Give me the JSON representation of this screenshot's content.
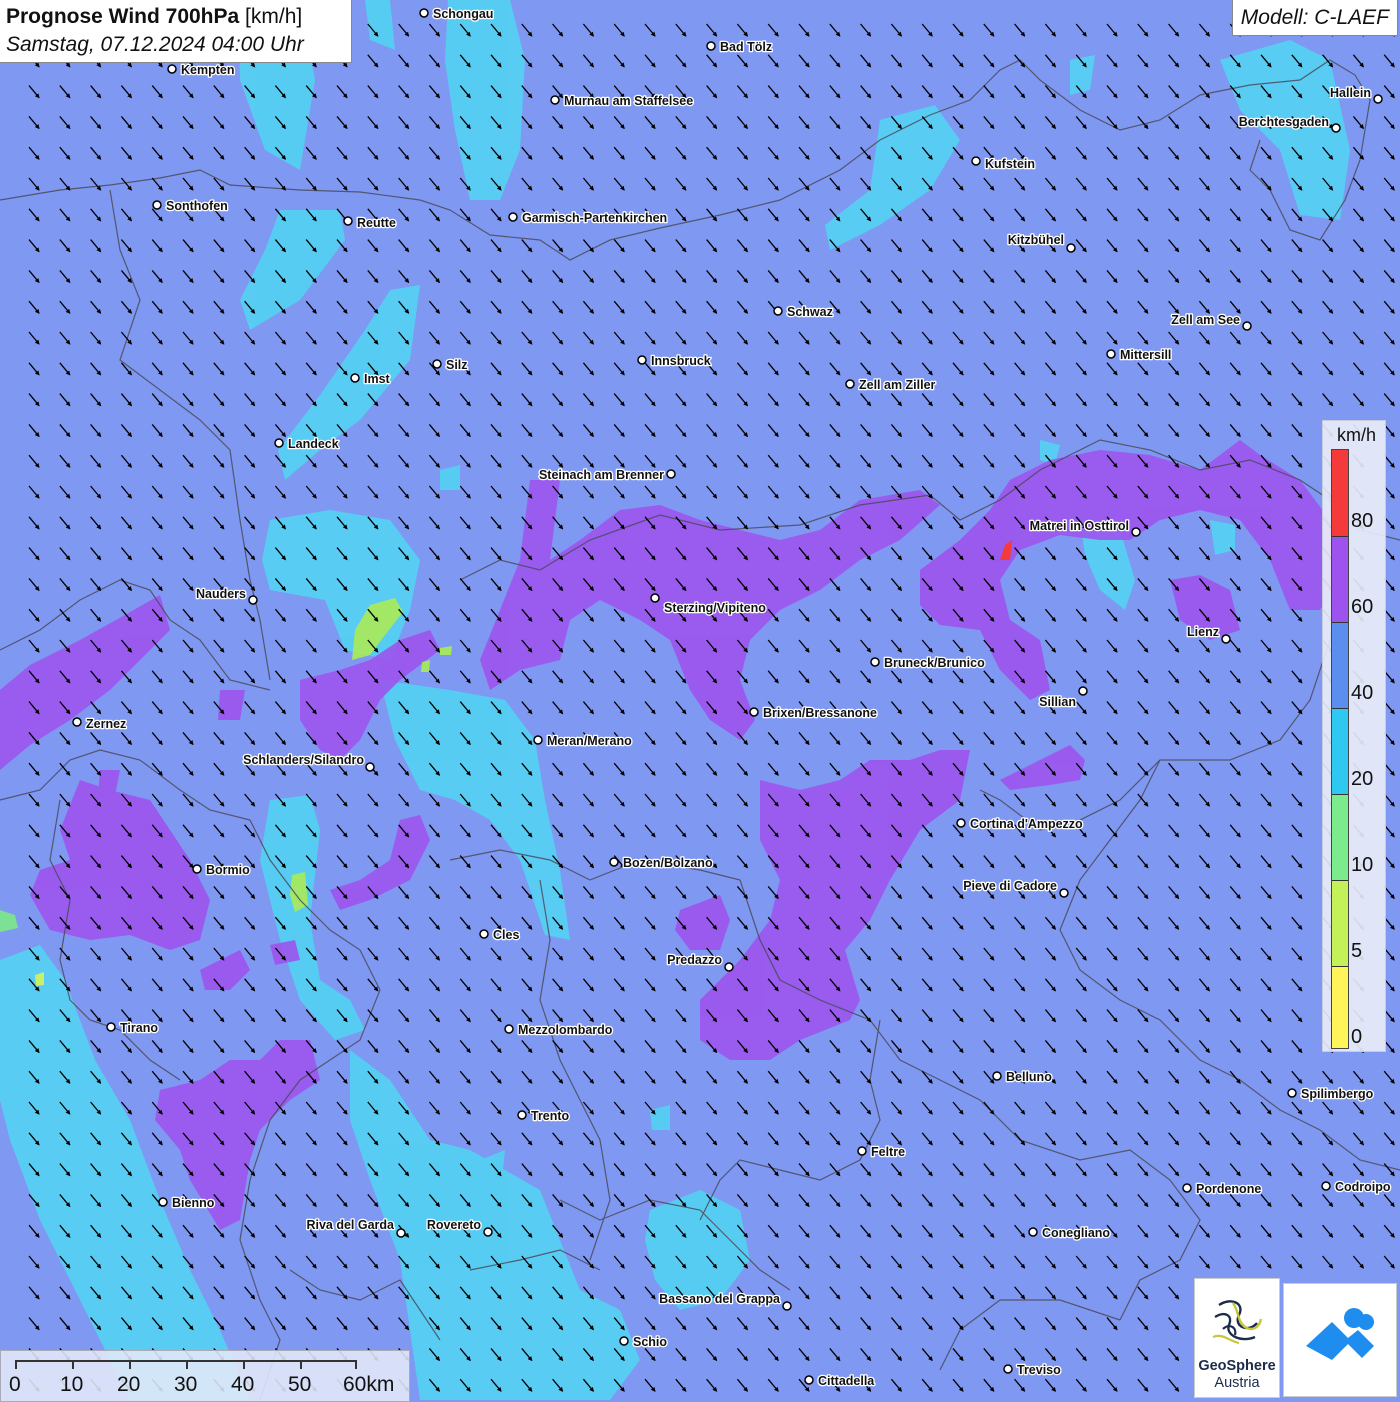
{
  "header": {
    "title_main": "Prognose Wind 700hPa",
    "title_unit": "[km/h]",
    "datetime": "Samstag, 07.12.2024 04:00 Uhr",
    "model": "Modell: C-LAEF"
  },
  "legend": {
    "unit": "km/h",
    "ticks": [
      "0",
      "5",
      "10",
      "20",
      "40",
      "60",
      "80"
    ],
    "colors": [
      "#fff45a",
      "#c3f258",
      "#7ceb8c",
      "#2ec8f0",
      "#5c8ef0",
      "#9e52ee",
      "#f43a3a"
    ]
  },
  "scale_bar": {
    "labels": [
      "0",
      "10",
      "20",
      "30",
      "40",
      "50",
      "60km"
    ]
  },
  "logo": {
    "name": "GeoSphere",
    "sub": "Austria"
  },
  "cities": [
    "Schongau",
    "Bad Tölz",
    "Kempten",
    "Murnau am Staffelsee",
    "Hallein",
    "Berchtesgaden",
    "Kufstein",
    "Sonthofen",
    "Reutte",
    "Garmisch-Partenkirchen",
    "Kitzbühel",
    "Schwaz",
    "Zell am See",
    "Innsbruck",
    "Silz",
    "Mittersill",
    "Imst",
    "Zell am Ziller",
    "Landeck",
    "Steinach am Brenner",
    "Matrei in Osttirol",
    "Nauders",
    "Sterzing/Vipiteno",
    "Lienz",
    "Bruneck/Brunico",
    "Sillian",
    "Brixen/Bressanone",
    "Zernez",
    "Meran/Merano",
    "Schlanders/Silandro",
    "Cortina d'Ampezzo",
    "Bozen/Bolzano",
    "Bormio",
    "Pieve di Cadore",
    "Cles",
    "Predazzo",
    "Tirano",
    "Mezzolombardo",
    "Belluno",
    "Spilimbergo",
    "Trento",
    "Feltre",
    "Pordenone",
    "Codroipo",
    "Bienno",
    "Riva del Garda",
    "Rovereto",
    "Conegliano",
    "Bassano del Grappa",
    "Schio",
    "Treviso",
    "Cittadella"
  ],
  "colors": {
    "background": "#7f98f2",
    "cyan": "#4fd8f2",
    "purple": "#9e52ee",
    "green": "#9ee860",
    "red": "#f43a3a"
  }
}
